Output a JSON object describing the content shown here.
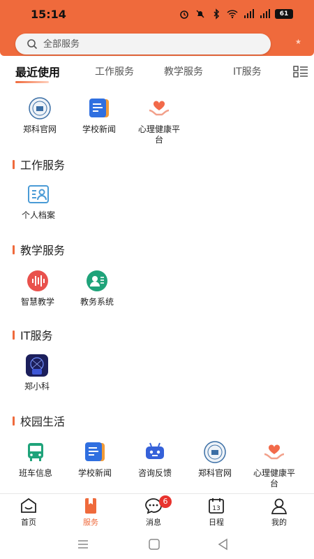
{
  "status": {
    "time": "15:14",
    "battery": "61"
  },
  "search": {
    "placeholder": "全部服务"
  },
  "tabs": [
    {
      "label": "最近使用"
    },
    {
      "label": "工作服务"
    },
    {
      "label": "教学服务"
    },
    {
      "label": "IT服务"
    }
  ],
  "recent": [
    {
      "label": "郑科官网"
    },
    {
      "label": "学校新闻"
    },
    {
      "label": "心理健康平\n台"
    }
  ],
  "sections": {
    "work": {
      "title": "工作服务",
      "apps": [
        {
          "label": "个人档案"
        }
      ]
    },
    "teaching": {
      "title": "教学服务",
      "apps": [
        {
          "label": "智慧教学"
        },
        {
          "label": "教务系统"
        }
      ]
    },
    "it": {
      "title": "IT服务",
      "apps": [
        {
          "label": "郑小科"
        }
      ]
    },
    "campus": {
      "title": "校园生活",
      "apps": [
        {
          "label": "班车信息"
        },
        {
          "label": "学校新闻"
        },
        {
          "label": "咨询反馈"
        },
        {
          "label": "郑科官网"
        },
        {
          "label": "心理健康平\n台"
        }
      ]
    }
  },
  "nav": [
    {
      "label": "首页"
    },
    {
      "label": "服务"
    },
    {
      "label": "消息",
      "badge": "6"
    },
    {
      "label": "日程"
    },
    {
      "label": "我的"
    }
  ],
  "colors": {
    "accent": "#ef6a3c",
    "badge": "#e8322d"
  }
}
